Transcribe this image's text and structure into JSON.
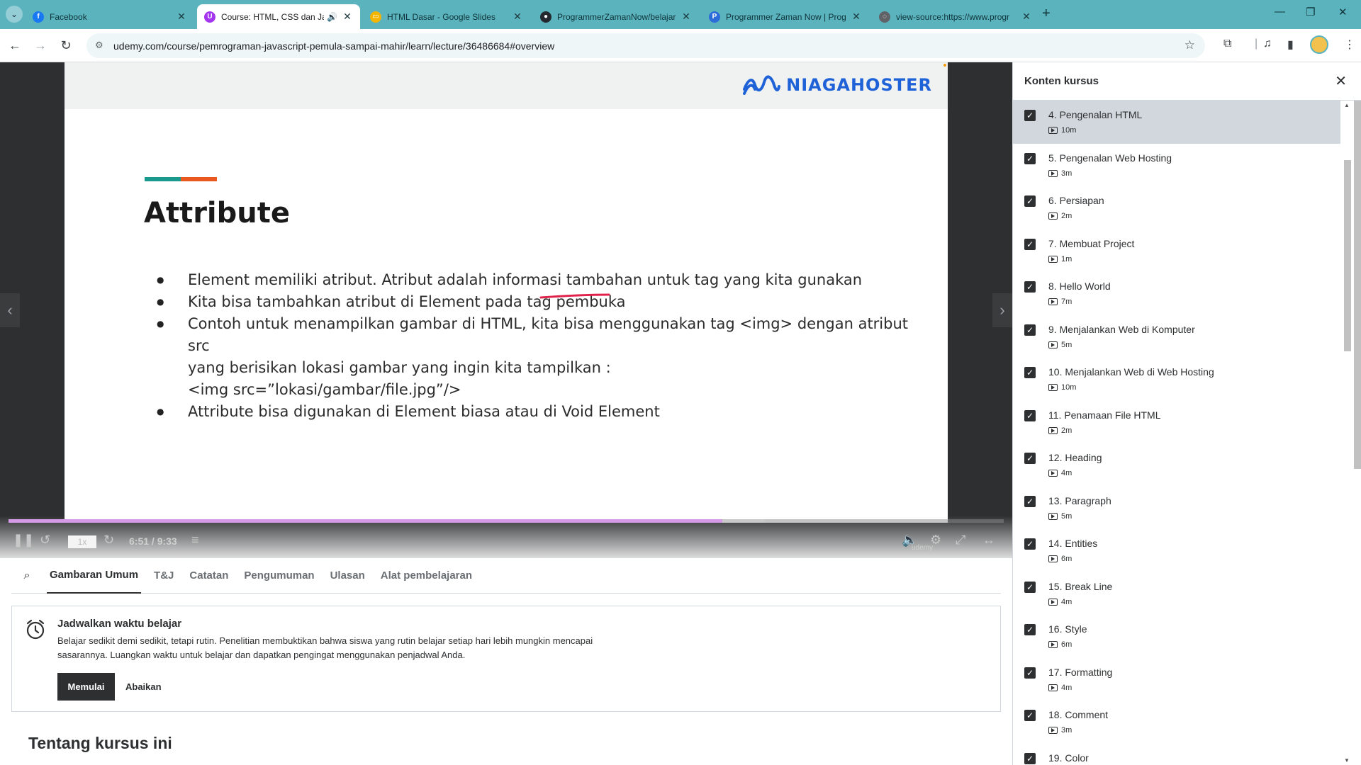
{
  "browser": {
    "tabs": [
      {
        "title": "Facebook",
        "favicon": "facebook-icon",
        "color": "#1877f2"
      },
      {
        "title": "Course: HTML, CSS dan Javas",
        "favicon": "udemy-icon",
        "color": "#a435f0",
        "active": true,
        "audio": true
      },
      {
        "title": "HTML Dasar - Google Slides",
        "favicon": "google-slides-icon",
        "color": "#f4b400"
      },
      {
        "title": "ProgrammerZamanNow/belajar",
        "favicon": "github-icon",
        "color": "#24292f"
      },
      {
        "title": "Programmer Zaman Now | Prog",
        "favicon": "pzn-icon",
        "color": "#2b6cd8"
      },
      {
        "title": "view-source:https://www.progr",
        "favicon": "globe-icon",
        "color": "#5f6368"
      }
    ],
    "url": "udemy.com/course/pemrograman-javascript-pemula-sampai-mahir/learn/lecture/36486684#overview"
  },
  "slide": {
    "brand": "NIAGAHOSTER",
    "title": "Attribute",
    "bullets": [
      "Element memiliki atribut. Atribut adalah informasi tambahan untuk tag yang kita gunakan",
      "Kita bisa tambahkan atribut di Element pada tag pembuka",
      "Contoh untuk menampilkan gambar di HTML, kita bisa menggunakan tag <img> dengan atribut src\nyang berisikan lokasi gambar yang ingin kita tampilkan :\n<img src=”lokasi/gambar/file.jpg”/>",
      "Attribute bisa digunakan di Element biasa atau di Void Element"
    ]
  },
  "player": {
    "speed": "1x",
    "time": "6:51 / 9:33",
    "progress_fraction": 0.717,
    "buffered_fraction": 0.76,
    "watermark": "udemy"
  },
  "tabs": {
    "items": [
      "Gambaran Umum",
      "T&J",
      "Catatan",
      "Pengumuman",
      "Ulasan",
      "Alat pembelajaran"
    ]
  },
  "reminder": {
    "title": "Jadwalkan waktu belajar",
    "text": "Belajar sedikit demi sedikit, tetapi rutin. Penelitian membuktikan bahwa siswa yang rutin belajar setiap hari lebih mungkin mencapai sasarannya. Luangkan waktu untuk belajar dan dapatkan pengingat menggunakan penjadwal Anda.",
    "start_label": "Memulai",
    "dismiss_label": "Abaikan"
  },
  "about_title": "Tentang kursus ini",
  "sidebar": {
    "title": "Konten kursus",
    "lectures": [
      {
        "title": "4. Pengenalan HTML",
        "duration": "10m",
        "current": true
      },
      {
        "title": "5. Pengenalan Web Hosting",
        "duration": "3m"
      },
      {
        "title": "6. Persiapan",
        "duration": "2m"
      },
      {
        "title": "7. Membuat Project",
        "duration": "1m"
      },
      {
        "title": "8. Hello World",
        "duration": "7m"
      },
      {
        "title": "9. Menjalankan Web di Komputer",
        "duration": "5m"
      },
      {
        "title": "10. Menjalankan Web di Web Hosting",
        "duration": "10m"
      },
      {
        "title": "11. Penamaan File HTML",
        "duration": "2m"
      },
      {
        "title": "12. Heading",
        "duration": "4m"
      },
      {
        "title": "13. Paragraph",
        "duration": "5m"
      },
      {
        "title": "14. Entities",
        "duration": "6m"
      },
      {
        "title": "15. Break Line",
        "duration": "4m"
      },
      {
        "title": "16. Style",
        "duration": "6m"
      },
      {
        "title": "17. Formatting",
        "duration": "4m"
      },
      {
        "title": "18. Comment",
        "duration": "3m"
      },
      {
        "title": "19. Color",
        "duration": ""
      }
    ]
  }
}
